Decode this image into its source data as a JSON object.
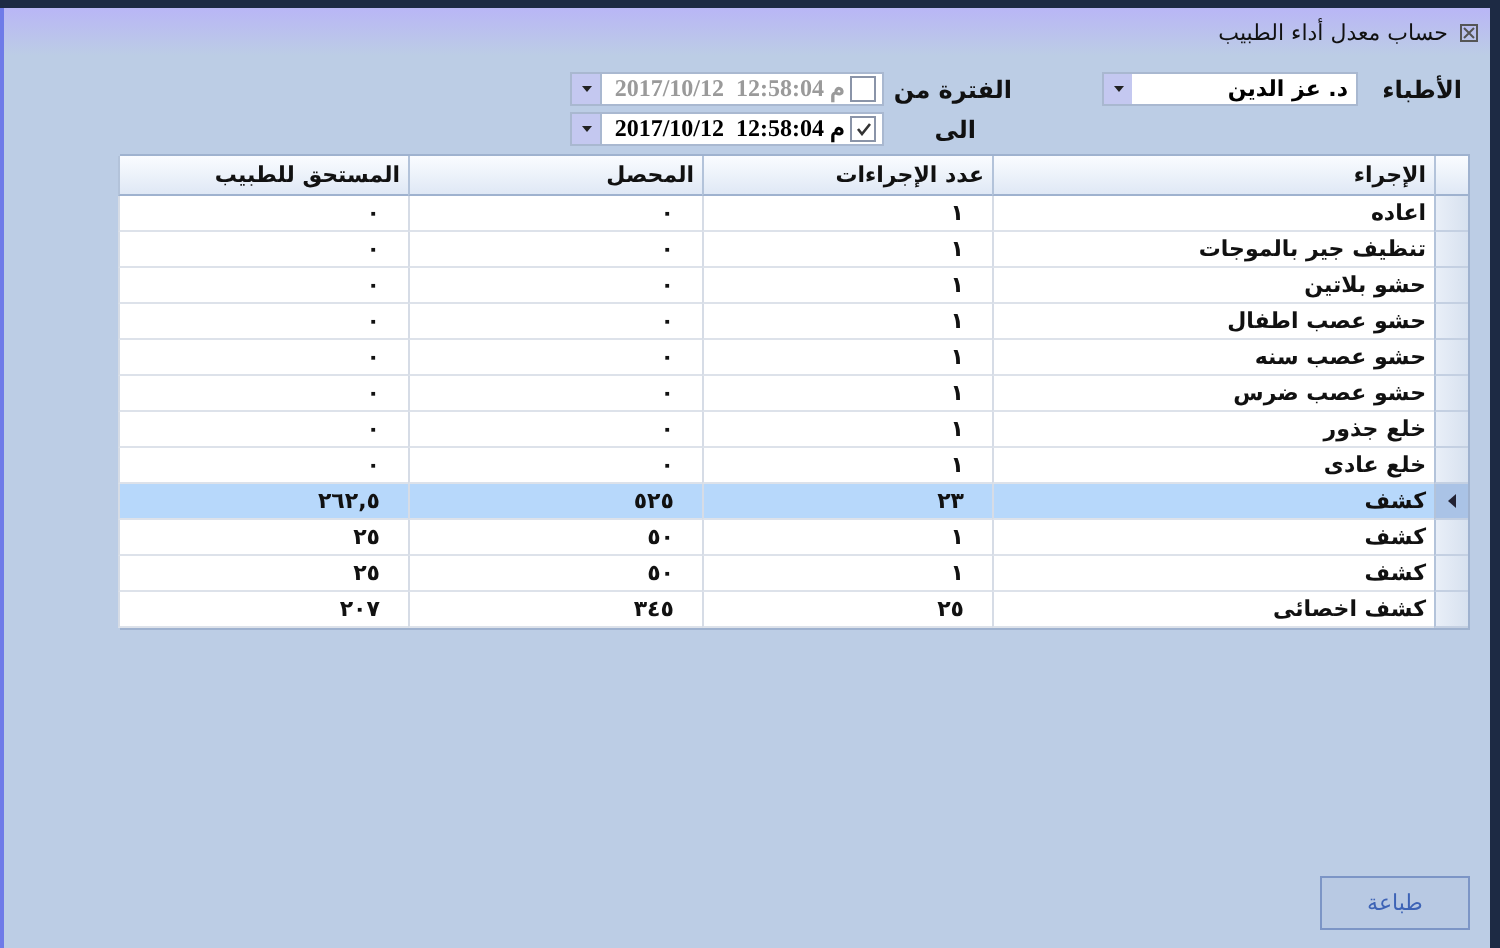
{
  "window": {
    "title": "حساب معدل أداء الطبيب"
  },
  "filters": {
    "doctors_label": "الأطباء",
    "doctor": "د. عز الدين",
    "from_label": "الفترة من",
    "to_label": "الى",
    "date_from": {
      "value": "2017/10/12  12:58:04 م",
      "checked": false
    },
    "date_to": {
      "value": "2017/10/12  12:58:04 م",
      "checked": true
    }
  },
  "table": {
    "columns": [
      "الإجراء",
      "عدد الإجراءات",
      "المحصل",
      "المستحق للطبيب"
    ],
    "rows": [
      {
        "cells": [
          "اعاده",
          "١",
          "٠",
          "٠"
        ],
        "selected": false
      },
      {
        "cells": [
          "تنظيف جير بالموجات",
          "١",
          "٠",
          "٠"
        ],
        "selected": false
      },
      {
        "cells": [
          "حشو بلاتين",
          "١",
          "٠",
          "٠"
        ],
        "selected": false
      },
      {
        "cells": [
          "حشو عصب اطفال",
          "١",
          "٠",
          "٠"
        ],
        "selected": false
      },
      {
        "cells": [
          "حشو عصب سنه",
          "١",
          "٠",
          "٠"
        ],
        "selected": false
      },
      {
        "cells": [
          "حشو عصب ضرس",
          "١",
          "٠",
          "٠"
        ],
        "selected": false
      },
      {
        "cells": [
          "خلع جذور",
          "١",
          "٠",
          "٠"
        ],
        "selected": false
      },
      {
        "cells": [
          "خلع عادى",
          "١",
          "٠",
          "٠"
        ],
        "selected": false
      },
      {
        "cells": [
          "كشف",
          "٢٣",
          "٥٢٥",
          "٢٦٢,٥"
        ],
        "selected": true
      },
      {
        "cells": [
          "كشف",
          "١",
          "٥٠",
          "٢٥"
        ],
        "selected": false
      },
      {
        "cells": [
          "كشف",
          "١",
          "٥٠",
          "٢٥"
        ],
        "selected": false
      },
      {
        "cells": [
          "كشف اخصائى",
          "٢٥",
          "٣٤٥",
          "٢٠٧"
        ],
        "selected": false
      }
    ]
  },
  "buttons": [
    "طباعة"
  ]
}
